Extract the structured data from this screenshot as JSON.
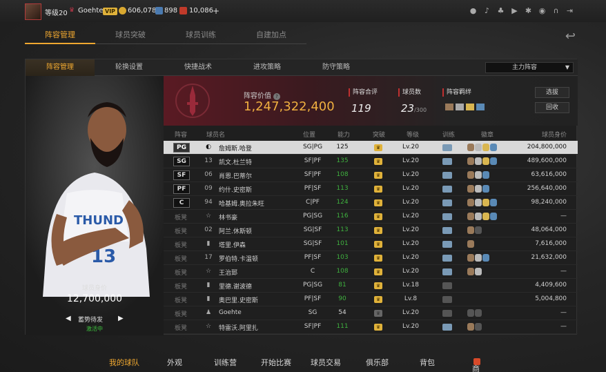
{
  "topbar": {
    "level": "等级20",
    "username": "Goehte",
    "vip": "VIP",
    "gold": "606,078",
    "tickets": "898",
    "points": "10,086",
    "plus": "+",
    "icons": [
      "user-icon",
      "bell-icon",
      "friends-icon",
      "video-icon",
      "gear-icon",
      "network-icon",
      "headset-icon",
      "exit-icon"
    ]
  },
  "main_tabs": [
    "阵容管理",
    "球员突破",
    "球员训练",
    "自建加点"
  ],
  "sub_tabs": [
    "阵容管理",
    "轮换设置",
    "快捷战术",
    "进攻策略",
    "防守策略"
  ],
  "lineup_select": "主力阵容",
  "card": {
    "value_label": "球员身价",
    "value": "12,700,000",
    "role": "蓄势待发",
    "status": "激活中"
  },
  "team": {
    "value_label": "阵容价值",
    "value": "1,247,322,400",
    "rating_label": "阵容合评",
    "rating": "119",
    "count_label": "球员数",
    "count": "23",
    "count_max": "/300",
    "chem_label": "阵容羁绊",
    "btn_select": "选拔",
    "btn_recycle": "回收"
  },
  "table_headers": {
    "lineup": "阵容",
    "name": "球员名",
    "position": "位置",
    "ability": "能力",
    "breakthrough": "突破",
    "level": "等级",
    "training": "训练",
    "badges": "徽章",
    "price": "球员身价"
  },
  "rows": [
    {
      "slot": "PG",
      "bench": false,
      "num": "◐",
      "name": "詹姆斯.哈登",
      "pos": "SG|PG",
      "ability": "125",
      "green": false,
      "crown": true,
      "level": "Lv.20",
      "train": true,
      "badges": [
        "#9a7a5a",
        "#bbbbbb",
        "#d9b650",
        "#5a8ab6"
      ],
      "price": "204,800,000",
      "selected": true
    },
    {
      "slot": "SG",
      "bench": false,
      "num": "13",
      "name": "凯文.杜兰特",
      "pos": "SF|PF",
      "ability": "135",
      "green": true,
      "crown": true,
      "level": "Lv.20",
      "train": true,
      "badges": [
        "#9a7a5a",
        "#bbbbbb",
        "#d9b650",
        "#5a8ab6"
      ],
      "price": "489,600,000",
      "selected": false
    },
    {
      "slot": "SF",
      "bench": false,
      "num": "06",
      "name": "肖恩.巴蒂尔",
      "pos": "SF|PF",
      "ability": "108",
      "green": true,
      "crown": true,
      "level": "Lv.20",
      "train": true,
      "badges": [
        "#9a7a5a",
        "#bbbbbb",
        "#5a8ab6"
      ],
      "price": "63,616,000",
      "selected": false
    },
    {
      "slot": "PF",
      "bench": false,
      "num": "09",
      "name": "约什.史密斯",
      "pos": "PF|SF",
      "ability": "113",
      "green": true,
      "crown": true,
      "level": "Lv.20",
      "train": true,
      "badges": [
        "#9a7a5a",
        "#bbbbbb",
        "#5a8ab6"
      ],
      "price": "256,640,000",
      "selected": false
    },
    {
      "slot": "C",
      "bench": false,
      "num": "94",
      "name": "哈基姆.奥拉朱旺",
      "pos": "C|PF",
      "ability": "124",
      "green": true,
      "crown": true,
      "level": "Lv.20",
      "train": true,
      "badges": [
        "#9a7a5a",
        "#bbbbbb",
        "#d9b650",
        "#5a8ab6"
      ],
      "price": "98,240,000",
      "selected": false
    },
    {
      "slot": "",
      "bench": true,
      "num": "☆",
      "name": "林书豪",
      "pos": "PG|SG",
      "ability": "116",
      "green": true,
      "crown": true,
      "level": "Lv.20",
      "train": true,
      "badges": [
        "#9a7a5a",
        "#bbbbbb",
        "#d9b650",
        "#5a8ab6"
      ],
      "price": "—",
      "selected": false
    },
    {
      "slot": "",
      "bench": true,
      "num": "02",
      "name": "阿兰.休斯顿",
      "pos": "SG|SF",
      "ability": "113",
      "green": true,
      "crown": true,
      "level": "Lv.20",
      "train": true,
      "badges": [
        "#9a7a5a",
        "#555555"
      ],
      "price": "48,064,000",
      "selected": false
    },
    {
      "slot": "",
      "bench": true,
      "num": "▮",
      "name": "塔里.伊森",
      "pos": "SG|SF",
      "ability": "101",
      "green": true,
      "crown": true,
      "level": "Lv.20",
      "train": true,
      "badges": [
        "#9a7a5a"
      ],
      "price": "7,616,000",
      "selected": false
    },
    {
      "slot": "",
      "bench": true,
      "num": "17",
      "name": "罗伯特.卡温顿",
      "pos": "PF|SF",
      "ability": "103",
      "green": true,
      "crown": true,
      "level": "Lv.20",
      "train": true,
      "badges": [
        "#9a7a5a",
        "#bbbbbb",
        "#5a8ab6"
      ],
      "price": "21,632,000",
      "selected": false
    },
    {
      "slot": "",
      "bench": true,
      "num": "☆",
      "name": "王治郅",
      "pos": "C",
      "ability": "108",
      "green": true,
      "crown": true,
      "level": "Lv.20",
      "train": true,
      "badges": [
        "#9a7a5a",
        "#bbbbbb"
      ],
      "price": "—",
      "selected": false
    },
    {
      "slot": "",
      "bench": true,
      "num": "▮",
      "name": "里德.谢波德",
      "pos": "PG|SG",
      "ability": "81",
      "green": true,
      "crown": true,
      "level": "Lv.18",
      "train": false,
      "badges": [],
      "price": "4,409,600",
      "selected": false
    },
    {
      "slot": "",
      "bench": true,
      "num": "▮",
      "name": "奥巴里.史密斯",
      "pos": "PF|SF",
      "ability": "90",
      "green": true,
      "crown": true,
      "level": "Lv.8",
      "train": false,
      "badges": [],
      "price": "5,004,800",
      "selected": false
    },
    {
      "slot": "",
      "bench": true,
      "num": "♟",
      "name": "Goehte",
      "pos": "SG",
      "ability": "54",
      "green": false,
      "crown": false,
      "level": "Lv.20",
      "train": false,
      "badges": [
        "#555555",
        "#555555"
      ],
      "price": "—",
      "selected": false
    },
    {
      "slot": "",
      "bench": true,
      "num": "☆",
      "name": "特雷沃.阿里扎",
      "pos": "SF|PF",
      "ability": "111",
      "green": true,
      "crown": true,
      "level": "Lv.20",
      "train": true,
      "badges": [
        "#9a7a5a",
        "#555555"
      ],
      "price": "—",
      "selected": false
    }
  ],
  "bench_label": "板凳",
  "bottom_nav": [
    "我的球队",
    "外观",
    "训练营",
    "开始比赛",
    "球员交易",
    "俱乐部",
    "背包",
    "商城"
  ],
  "colors": {
    "accent": "#f0a830",
    "green": "#3fb23f",
    "team_red": "#5a1a23"
  }
}
